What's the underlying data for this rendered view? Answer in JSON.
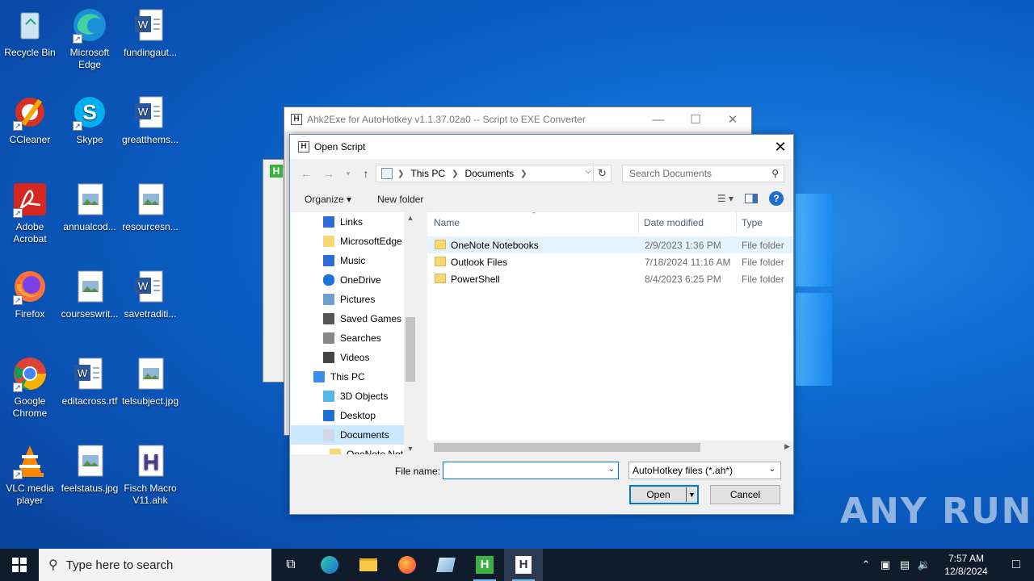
{
  "desktop": {
    "icons": [
      {
        "label": "Recycle Bin",
        "icon": "recycle-bin-icon"
      },
      {
        "label": "Microsoft Edge",
        "icon": "edge-icon"
      },
      {
        "label": "fundingaut...",
        "icon": "word-doc-icon"
      },
      {
        "label": "CCleaner",
        "icon": "ccleaner-icon"
      },
      {
        "label": "Skype",
        "icon": "skype-icon"
      },
      {
        "label": "greatthems...",
        "icon": "word-doc-icon"
      },
      {
        "label": "Adobe Acrobat",
        "icon": "acrobat-icon"
      },
      {
        "label": "annualcod...",
        "icon": "image-file-icon"
      },
      {
        "label": "resourcesn...",
        "icon": "image-file-icon"
      },
      {
        "label": "Firefox",
        "icon": "firefox-icon"
      },
      {
        "label": "courseswrit...",
        "icon": "image-file-icon"
      },
      {
        "label": "savetraditi...",
        "icon": "word-doc-icon"
      },
      {
        "label": "Google Chrome",
        "icon": "chrome-icon"
      },
      {
        "label": "editacross.rtf",
        "icon": "word-doc-icon"
      },
      {
        "label": "telsubject.jpg",
        "icon": "image-file-icon"
      },
      {
        "label": "VLC media player",
        "icon": "vlc-icon"
      },
      {
        "label": "feelstatus.jpg",
        "icon": "image-file-icon"
      },
      {
        "label": "Fisch Macro V11.ahk",
        "icon": "ahk-file-icon"
      }
    ]
  },
  "ahk_window": {
    "title": "Ahk2Exe for AutoHotkey v1.1.37.02a0 -- Script to EXE Converter"
  },
  "dialog": {
    "title": "Open Script",
    "address": {
      "root": "This PC",
      "folder": "Documents"
    },
    "search_placeholder": "Search Documents",
    "toolbar": {
      "organize": "Organize ▾",
      "new_folder": "New folder"
    },
    "nav_items": [
      {
        "label": "Links",
        "icon": "links-icon"
      },
      {
        "label": "MicrosoftEdge",
        "icon": "folder-icon"
      },
      {
        "label": "Music",
        "icon": "music-icon"
      },
      {
        "label": "OneDrive",
        "icon": "onedrive-icon"
      },
      {
        "label": "Pictures",
        "icon": "pictures-icon"
      },
      {
        "label": "Saved Games",
        "icon": "saved-games-icon"
      },
      {
        "label": "Searches",
        "icon": "searches-icon"
      },
      {
        "label": "Videos",
        "icon": "videos-icon"
      },
      {
        "label": "This PC",
        "icon": "this-pc-icon"
      },
      {
        "label": "3D Objects",
        "icon": "3d-objects-icon"
      },
      {
        "label": "Desktop",
        "icon": "desktop-folder-icon"
      },
      {
        "label": "Documents",
        "icon": "documents-icon"
      },
      {
        "label": "OneNote Not",
        "icon": "folder-icon"
      }
    ],
    "columns": {
      "name": "Name",
      "date": "Date modified",
      "type": "Type"
    },
    "files": [
      {
        "name": "OneNote Notebooks",
        "date": "2/9/2023 1:36 PM",
        "type": "File folder"
      },
      {
        "name": "Outlook Files",
        "date": "7/18/2024 11:16 AM",
        "type": "File folder"
      },
      {
        "name": "PowerShell",
        "date": "8/4/2023 6:25 PM",
        "type": "File folder"
      }
    ],
    "file_name_label": "File name:",
    "file_name_value": "",
    "filter": "AutoHotkey files (*.ah*)",
    "open_label": "Open",
    "cancel_label": "Cancel"
  },
  "taskbar": {
    "search_placeholder": "Type here to search",
    "time": "7:57 AM",
    "date": "12/8/2024"
  },
  "watermark": "ANY RUN"
}
